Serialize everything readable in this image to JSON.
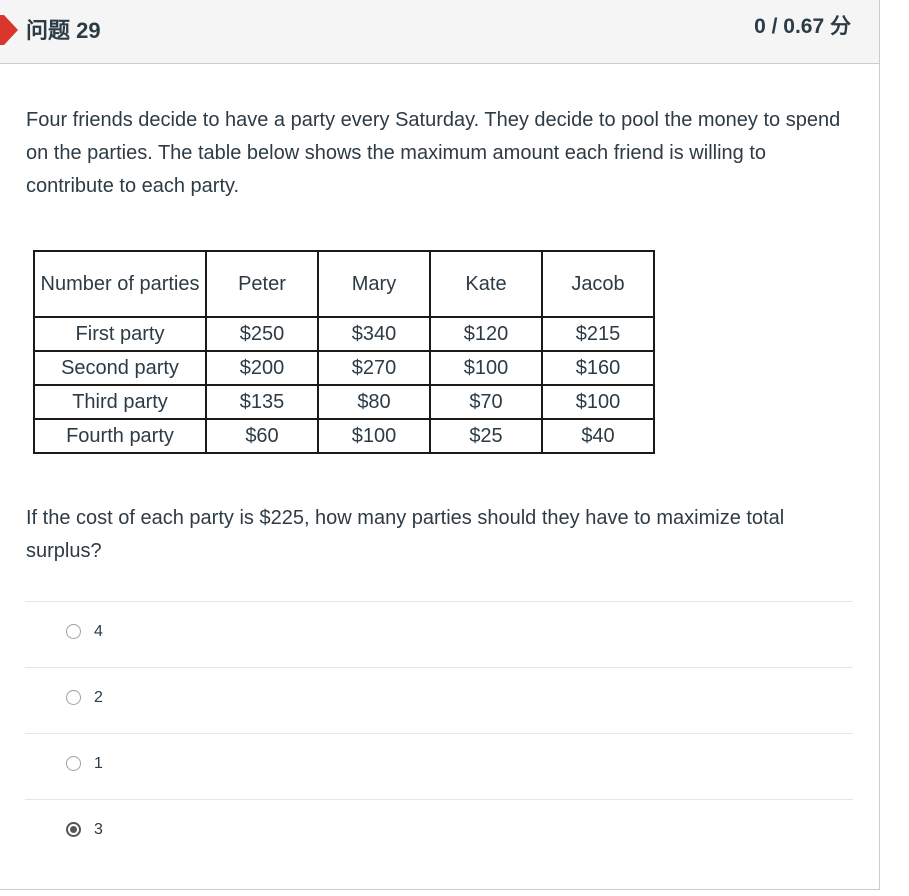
{
  "question": {
    "title": "问题 29",
    "points": "0 / 0.67 分",
    "text": "Four friends decide to have a party every Saturday. They decide to pool the money to spend on the parties. The table below shows the maximum amount each friend is willing to contribute to each party.",
    "followup": "If the cost of each party is $225, how many parties should they have to maximize total surplus?"
  },
  "table": {
    "headers": [
      "Number of parties",
      "Peter",
      "Mary",
      "Kate",
      "Jacob"
    ],
    "rows": [
      [
        "First party",
        "$250",
        "$340",
        "$120",
        "$215"
      ],
      [
        "Second party",
        "$200",
        "$270",
        "$100",
        "$160"
      ],
      [
        "Third party",
        "$135",
        "$80",
        "$70",
        "$100"
      ],
      [
        "Fourth party",
        "$60",
        "$100",
        "$25",
        "$40"
      ]
    ]
  },
  "answers": [
    {
      "label": "4",
      "selected": false
    },
    {
      "label": "2",
      "selected": false
    },
    {
      "label": "1",
      "selected": false
    },
    {
      "label": "3",
      "selected": true
    }
  ],
  "colors": {
    "flag": "#d9372b",
    "text": "#2d3b45",
    "header_bg": "#f5f5f5"
  }
}
